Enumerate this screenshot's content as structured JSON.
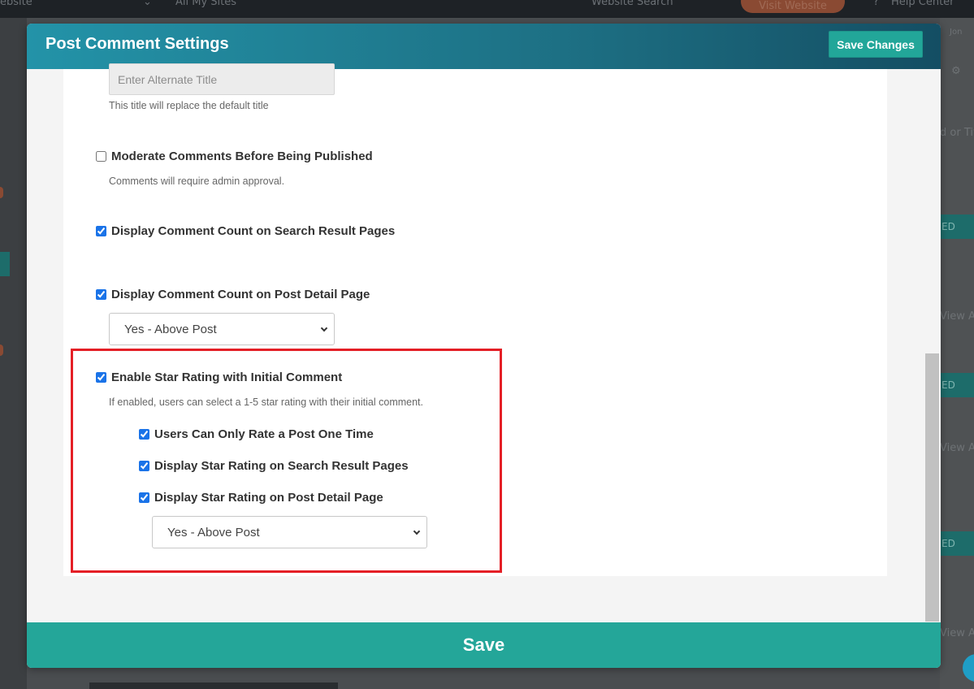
{
  "background": {
    "topbar_fragments": [
      "ebsite",
      "All My Sites",
      "Website Search",
      "Visit Website",
      "Help Center"
    ],
    "right_fragments": [
      "Jon",
      "d or Title",
      "ED",
      "View A",
      "ED",
      "View A",
      "ED",
      "View A"
    ]
  },
  "modal": {
    "title": "Post Comment Settings",
    "save_changes_label": "Save Changes",
    "save_label": "Save"
  },
  "form": {
    "alternate_title": {
      "placeholder": "Enter Alternate Title",
      "help": "This title will replace the default title"
    },
    "moderate_comments": {
      "label": "Moderate Comments Before Being Published",
      "checked": false,
      "help": "Comments will require admin approval."
    },
    "comment_count_search": {
      "label": "Display Comment Count on Search Result Pages",
      "checked": true
    },
    "comment_count_detail": {
      "label": "Display Comment Count on Post Detail Page",
      "checked": true,
      "select_value": "Yes - Above Post"
    },
    "star_rating": {
      "label": "Enable Star Rating with Initial Comment",
      "checked": true,
      "help": "If enabled, users can select a 1-5 star rating with their initial comment.",
      "options": [
        {
          "label": "Users Can Only Rate a Post One Time",
          "checked": true
        },
        {
          "label": "Display Star Rating on Search Result Pages",
          "checked": true
        },
        {
          "label": "Display Star Rating on Post Detail Page",
          "checked": true
        }
      ],
      "select_value": "Yes - Above Post"
    }
  },
  "colors": {
    "header_gradient_start": "#2393a8",
    "header_gradient_end": "#144e63",
    "accent_green": "#24a699",
    "highlight_red": "#e41f26",
    "checkbox_blue": "#1a73e8"
  }
}
